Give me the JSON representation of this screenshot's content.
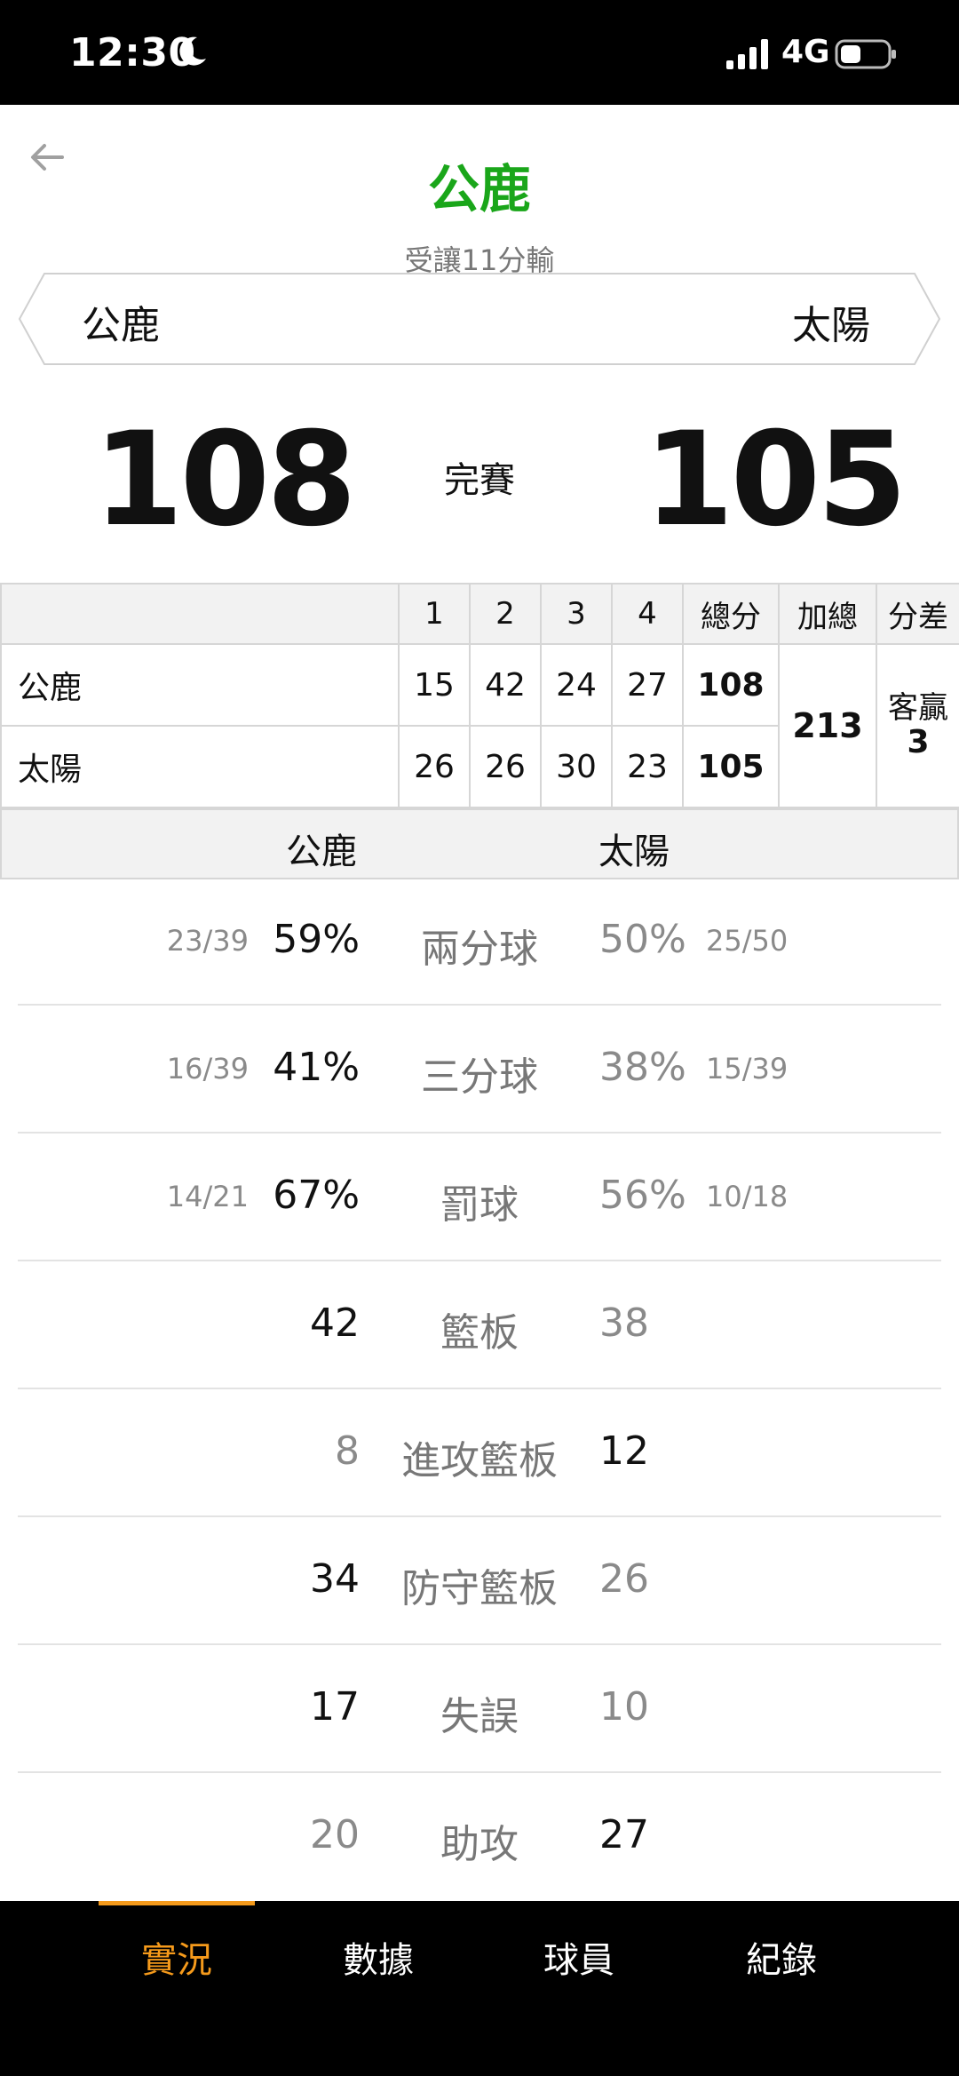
{
  "status_bar": {
    "time": "12:30",
    "network": "4G"
  },
  "header": {
    "title": "公鹿",
    "subtitle": "受讓11分輸"
  },
  "teams": {
    "home": "公鹿",
    "away": "太陽"
  },
  "score": {
    "home": "108",
    "away": "105",
    "status": "完賽"
  },
  "box_score": {
    "headers": [
      "",
      "1",
      "2",
      "3",
      "4",
      "總分",
      "加總",
      "分差"
    ],
    "rows": [
      {
        "team": "公鹿",
        "quarters": [
          "15",
          "42",
          "24",
          "27"
        ],
        "total": "108"
      },
      {
        "team": "太陽",
        "quarters": [
          "26",
          "26",
          "30",
          "23"
        ],
        "total": "105"
      }
    ],
    "combined": "213",
    "diff_label": "客贏",
    "diff_value": "3"
  },
  "team_stats": {
    "home_label": "公鹿",
    "away_label": "太陽",
    "rows": [
      {
        "label": "兩分球",
        "home_frac": "23/39",
        "home": "59%",
        "away": "50%",
        "away_frac": "25/50"
      },
      {
        "label": "三分球",
        "home_frac": "16/39",
        "home": "41%",
        "away": "38%",
        "away_frac": "15/39"
      },
      {
        "label": "罰球",
        "home_frac": "14/21",
        "home": "67%",
        "away": "56%",
        "away_frac": "10/18"
      },
      {
        "label": "籃板",
        "home_frac": "",
        "home": "42",
        "away": "38",
        "away_frac": ""
      },
      {
        "label": "進攻籃板",
        "home_frac": "",
        "home": "8",
        "away": "12",
        "away_frac": ""
      },
      {
        "label": "防守籃板",
        "home_frac": "",
        "home": "34",
        "away": "26",
        "away_frac": ""
      },
      {
        "label": "失誤",
        "home_frac": "",
        "home": "17",
        "away": "10",
        "away_frac": ""
      },
      {
        "label": "助攻",
        "home_frac": "",
        "home": "20",
        "away": "27",
        "away_frac": ""
      }
    ]
  },
  "tabs": [
    {
      "label": "實況",
      "active": true
    },
    {
      "label": "數據",
      "active": false
    },
    {
      "label": "球員",
      "active": false
    },
    {
      "label": "紀錄",
      "active": false
    }
  ],
  "colors": {
    "title_green": "#1aa61a",
    "accent_orange": "#f59a1b"
  }
}
